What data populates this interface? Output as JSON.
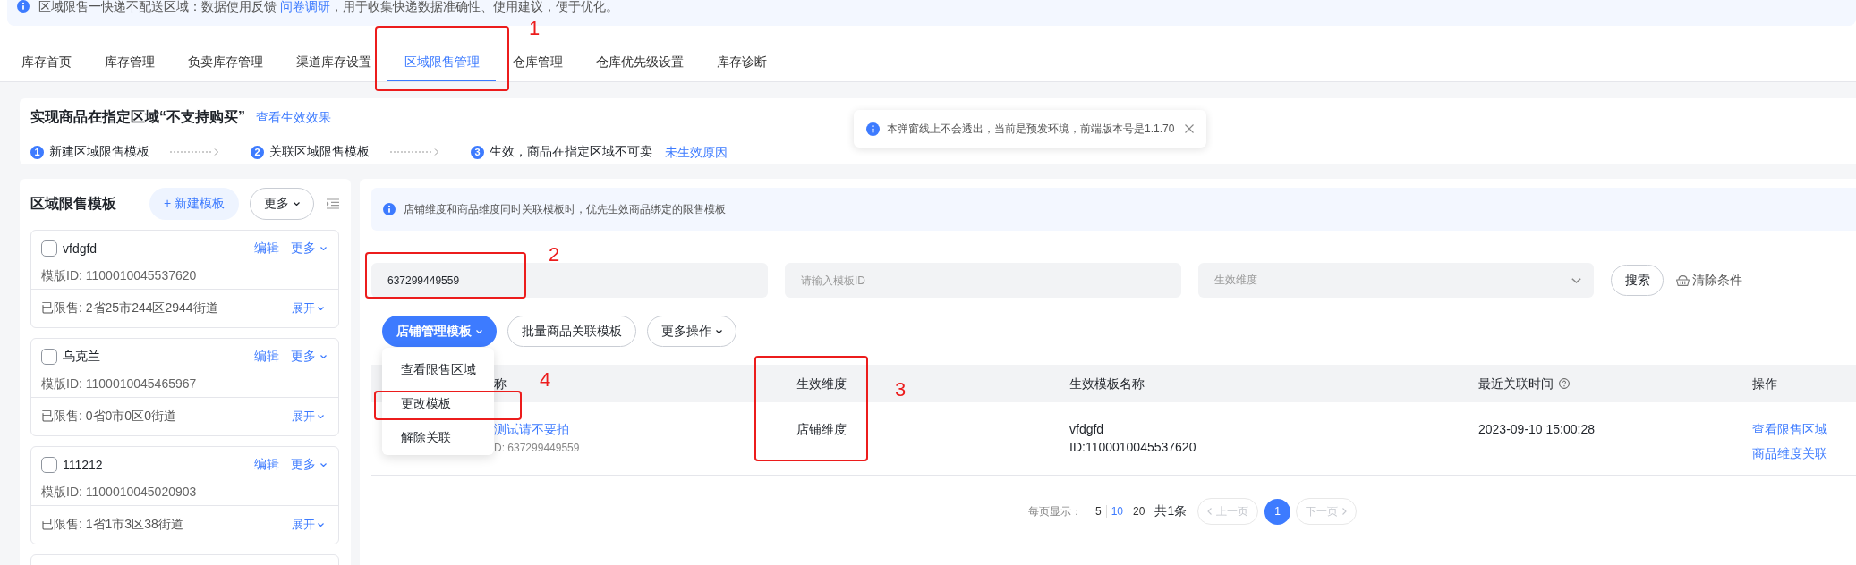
{
  "notice": {
    "text": "区域限售一快递不配送区域：数据使用反馈 ",
    "link": "问卷调研",
    "text_after": "，用于收集快递数据准确性、使用建议，便于优化。"
  },
  "tabs": [
    {
      "label": "库存首页",
      "selected": false
    },
    {
      "label": "库存管理",
      "selected": false
    },
    {
      "label": "负卖库存管理",
      "selected": false
    },
    {
      "label": "渠道库存设置",
      "selected": false
    },
    {
      "label": "区域限售管理",
      "selected": true
    },
    {
      "label": "仓库管理",
      "selected": false
    },
    {
      "label": "仓库优先级设置",
      "selected": false
    },
    {
      "label": "库存诊断",
      "selected": false
    }
  ],
  "intro": {
    "title": "实现商品在指定区域“不支持购买”",
    "link": "查看生效效果",
    "steps": [
      {
        "number": "1",
        "label": "新建区域限售模板"
      },
      {
        "number": "2",
        "label": "关联区域限售模板"
      },
      {
        "number": "3",
        "label": "生效，商品在指定区域不可卖",
        "link": "未生效原因"
      }
    ]
  },
  "toast": {
    "message": "本弹窗线上不会透出，当前是预发环境，前端版本号是1.1.70"
  },
  "template_panel": {
    "title": "区域限售模板",
    "new_button": "+ 新建模板",
    "more_button": "更多",
    "templates": [
      {
        "kind": "full",
        "checked": false,
        "name": "vfdgfd",
        "edit": "编辑",
        "more": "更多",
        "template_id": "模版ID: 1100010045537620",
        "restricted": "已限售: 2省25市244区2944街道",
        "expand": "展开"
      },
      {
        "kind": "full",
        "checked": false,
        "name": "乌克兰",
        "edit": "编辑",
        "more": "更多",
        "template_id": "模版ID: 1100010045465967",
        "restricted": "已限售: 0省0市0区0街道",
        "expand": "展开"
      },
      {
        "kind": "full",
        "checked": false,
        "name": "111212",
        "edit": "编辑",
        "more": "更多",
        "template_id": "模版ID: 1100010045020903",
        "restricted": "已限售: 1省1市3区38街道",
        "expand": "展开"
      },
      {
        "kind": "partial"
      }
    ]
  },
  "association_panel": {
    "alert": "店铺维度和商品维度同时关联模板时，优先生效商品绑定的限售模板",
    "filters": [
      {
        "kind": "input",
        "value": "637299449559"
      },
      {
        "kind": "input",
        "placeholder": "请输入模板ID"
      },
      {
        "kind": "select",
        "placeholder": "生效维度"
      }
    ],
    "search_button": "搜索",
    "clear_button": "清除条件",
    "actions": [
      {
        "label": "店铺管理模板",
        "kind": "primary",
        "caret": true,
        "menu": [
          "查看限售区域",
          "更改模板",
          "解除关联"
        ]
      },
      {
        "label": "批量商品关联模板",
        "kind": "default",
        "caret": false
      },
      {
        "label": "更多操作",
        "kind": "default",
        "caret": true
      }
    ],
    "table": {
      "columns": [
        {
          "label": "称",
          "help_icon": false
        },
        {
          "label": "生效维度",
          "help_icon": false
        },
        {
          "label": "生效模板名称",
          "help_icon": false
        },
        {
          "label": "最近关联时间",
          "help_icon": true
        },
        {
          "label": "操作",
          "help_icon": false
        }
      ],
      "rows": [
        {
          "name": "测试请不要拍",
          "id": "D: 637299449559",
          "dimension": "店铺维度",
          "template_name": "vfdgfd",
          "template_id": "ID:1100010045537620",
          "linked_at": "2023-09-10 15:00:28",
          "operations": [
            "查看限售区域",
            "商品维度关联"
          ]
        }
      ]
    },
    "pagination": {
      "label": "每页显示：",
      "page_sizes": [
        {
          "label": "5",
          "selected": false
        },
        {
          "label": "10",
          "selected": true
        },
        {
          "label": "20",
          "selected": false
        }
      ],
      "total": "共1条",
      "prev": {
        "label": "上一页",
        "disabled": true
      },
      "pages": [
        {
          "label": "1",
          "selected": true
        }
      ],
      "next": {
        "label": "下一页",
        "disabled": true
      }
    }
  },
  "annotations": [
    {
      "number": "1"
    },
    {
      "number": "2"
    },
    {
      "number": "4"
    },
    {
      "number": "3"
    }
  ]
}
